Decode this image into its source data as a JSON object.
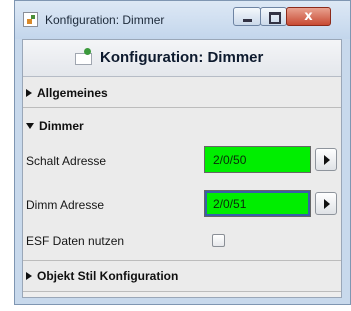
{
  "window": {
    "title": "Konfiguration: Dimmer",
    "close_symbol": "x"
  },
  "header": {
    "title": "Konfiguration: Dimmer",
    "icon": "edit-icon"
  },
  "sections": {
    "allgemeines": {
      "label": "Allgemeines",
      "expanded": false
    },
    "dimmer": {
      "label": "Dimmer",
      "expanded": true,
      "rows": {
        "schalt": {
          "label": "Schalt Adresse",
          "value": "2/0/50"
        },
        "dimm": {
          "label": "Dimm Adresse",
          "value": "2/0/51"
        },
        "esf": {
          "label": "ESF Daten nutzen",
          "checked": false
        }
      }
    },
    "objekt_stil": {
      "label": "Objekt Stil Konfiguration",
      "expanded": false
    }
  },
  "colors": {
    "field_background": "#00ee00",
    "window_frame": "#c8d9ec"
  }
}
